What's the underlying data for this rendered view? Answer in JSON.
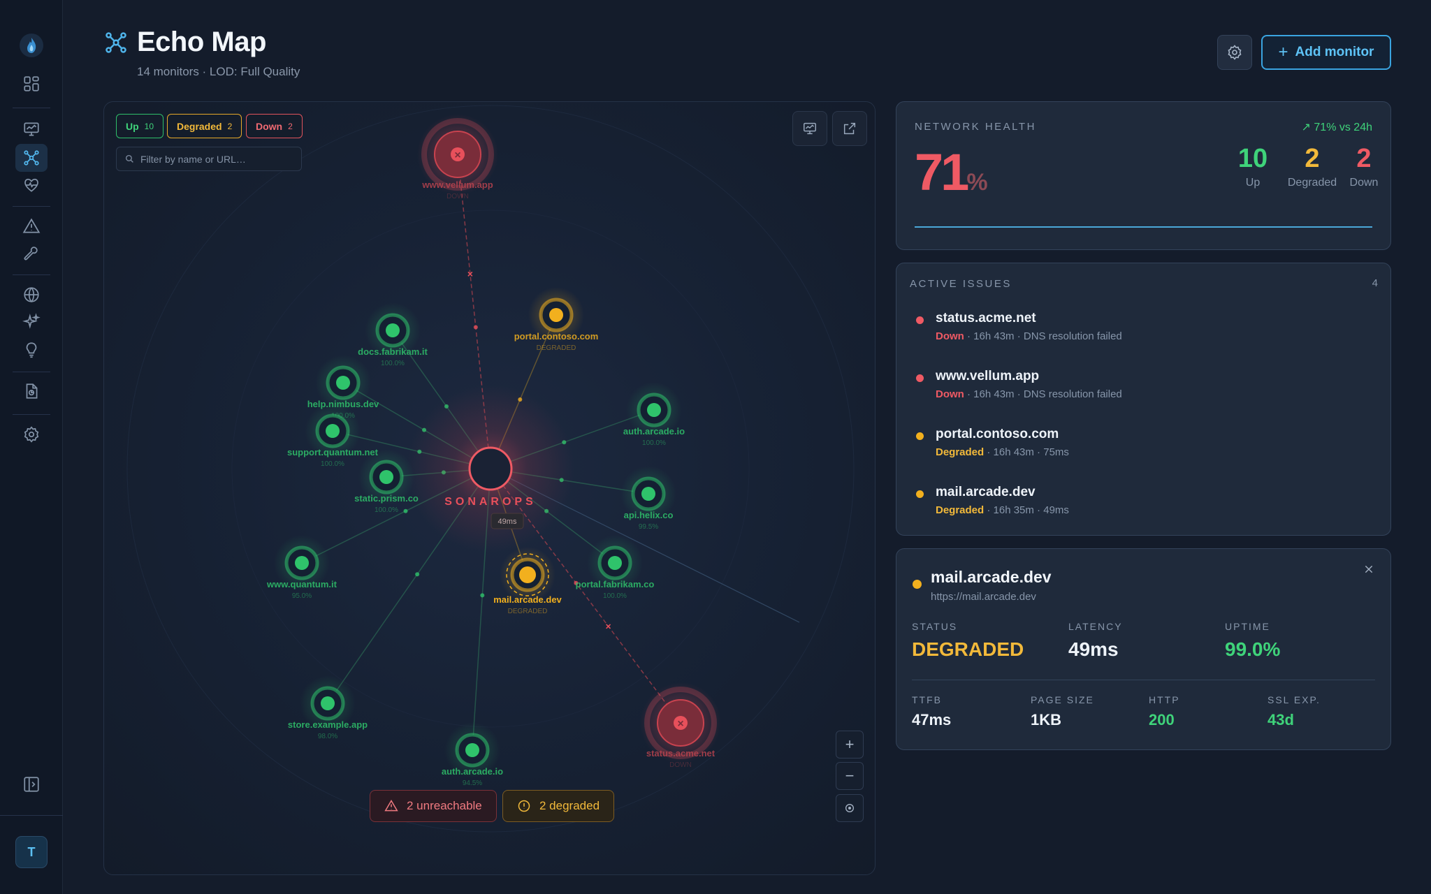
{
  "sidebar": {
    "logo": "flame-logo",
    "items": [
      "dashboard-icon",
      "monitor-icon",
      "network-icon",
      "heartbeat-icon",
      "alert-icon",
      "wrench-icon",
      "globe-icon",
      "sparkle-icon",
      "bulb-icon",
      "report-icon",
      "settings-icon",
      "collapse-icon"
    ],
    "active": "network-icon",
    "avatar": "T"
  },
  "header": {
    "title": "Echo Map",
    "subtitle": "14 monitors · LOD: Full Quality",
    "add_button": "Add monitor"
  },
  "map": {
    "chips": {
      "up_label": "Up",
      "up_count": "10",
      "degraded_label": "Degraded",
      "degraded_count": "2",
      "down_label": "Down",
      "down_count": "2"
    },
    "filter_placeholder": "Filter by name or URL…",
    "hub": {
      "name": "SONAROPS",
      "latency": "49ms"
    },
    "nodes": [
      {
        "name": "www.vellum.app",
        "status": "down",
        "sub": "DOWN"
      },
      {
        "name": "portal.contoso.com",
        "status": "degraded",
        "sub": "DEGRADED"
      },
      {
        "name": "docs.fabrikam.it",
        "status": "up",
        "sub": "100.0%"
      },
      {
        "name": "help.nimbus.dev",
        "status": "up",
        "sub": "100.0%"
      },
      {
        "name": "support.quantum.net",
        "status": "up",
        "sub": "100.0%"
      },
      {
        "name": "static.prism.co",
        "status": "up",
        "sub": "100.0%"
      },
      {
        "name": "auth.arcade.io",
        "status": "up",
        "sub": "100.0%"
      },
      {
        "name": "api.helix.co",
        "status": "up",
        "sub": "99.5%"
      },
      {
        "name": "www.quantum.it",
        "status": "up",
        "sub": "95.0%"
      },
      {
        "name": "mail.arcade.dev",
        "status": "degraded",
        "sub": "DEGRADED"
      },
      {
        "name": "portal.fabrikam.co",
        "status": "up",
        "sub": "100.0%"
      },
      {
        "name": "store.example.app",
        "status": "up",
        "sub": "98.0%"
      },
      {
        "name": "auth.arcade.io",
        "status": "up",
        "sub": "94.5%"
      },
      {
        "name": "status.acme.net",
        "status": "down",
        "sub": "DOWN"
      }
    ],
    "pills": {
      "unreachable": "2 unreachable",
      "degraded": "2 degraded"
    }
  },
  "health": {
    "label": "NETWORK HEALTH",
    "value": "71",
    "unit": "%",
    "trend": "71% vs 24h",
    "up": "10",
    "up_label": "Up",
    "degraded": "2",
    "degraded_label": "Degraded",
    "down": "2",
    "down_label": "Down"
  },
  "issues": {
    "label": "ACTIVE ISSUES",
    "count": "4",
    "items": [
      {
        "name": "status.acme.net",
        "state": "Down",
        "meta": " · 16h 43m · DNS resolution failed"
      },
      {
        "name": "www.vellum.app",
        "state": "Down",
        "meta": " · 16h 43m · DNS resolution failed"
      },
      {
        "name": "portal.contoso.com",
        "state": "Degraded",
        "meta": " · 16h 43m · 75ms"
      },
      {
        "name": "mail.arcade.dev",
        "state": "Degraded",
        "meta": " · 16h 35m · 49ms"
      }
    ]
  },
  "detail": {
    "name": "mail.arcade.dev",
    "url": "https://mail.arcade.dev",
    "status_label": "STATUS",
    "status": "DEGRADED",
    "latency_label": "LATENCY",
    "latency": "49ms",
    "uptime_label": "UPTIME",
    "uptime": "99.0%",
    "ttfb_label": "TTFB",
    "ttfb": "47ms",
    "pagesize_label": "PAGE SIZE",
    "pagesize": "1KB",
    "http_label": "HTTP",
    "http": "200",
    "ssl_label": "SSL EXP.",
    "ssl": "43d"
  },
  "colors": {
    "up": "#2fc36b",
    "degraded": "#f2b01e",
    "down": "#e8505b",
    "accent": "#3aa4e0"
  }
}
